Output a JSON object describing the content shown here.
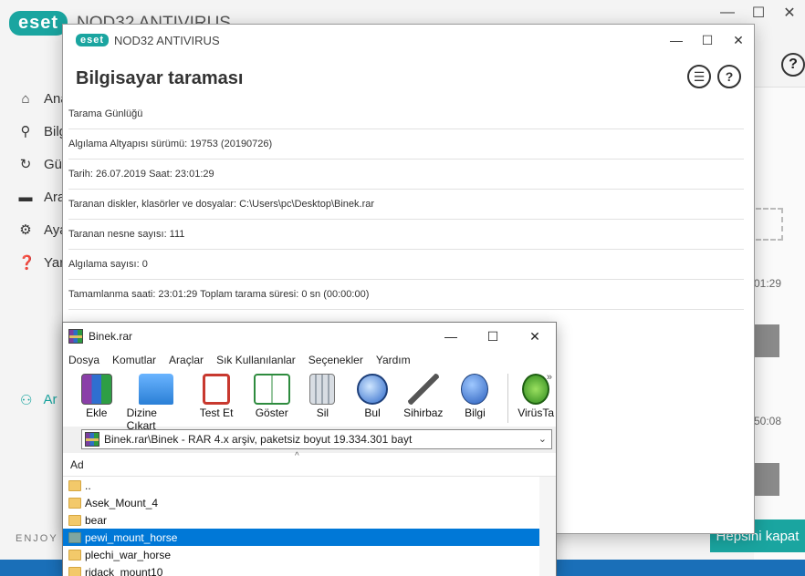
{
  "background_app": {
    "logo": "eset",
    "title": "NOD32 ANTIVIRUS",
    "window_controls": {
      "minimize": "—",
      "maximize": "☐",
      "close": "✕"
    },
    "help_label": "?",
    "nav_items": [
      {
        "label": "Ana",
        "icon": "home-icon"
      },
      {
        "label": "Bilg",
        "icon": "search-icon"
      },
      {
        "label": "Gü",
        "icon": "refresh-icon"
      },
      {
        "label": "Ara",
        "icon": "toolbox-icon"
      },
      {
        "label": "Aya",
        "icon": "gear-icon"
      },
      {
        "label": "Yar",
        "icon": "question-icon"
      }
    ],
    "nav_footer_item": "Ar",
    "enjoy_text": "ENJOY S",
    "right_times": [
      "01:29",
      "50:08"
    ],
    "hepsini_kapat": "Hepsini kapat"
  },
  "scan_window": {
    "logo": "eset",
    "title": "NOD32 ANTIVIRUS",
    "heading": "Bilgisayar taraması",
    "window_controls": {
      "minimize": "—",
      "maximize": "☐",
      "close": "✕"
    },
    "list_icon_label": "☰",
    "help_label": "?",
    "log_rows": [
      "Tarama Günlüğü",
      "Algılama Altyapısı sürümü: 19753 (20190726)",
      "Tarih: 26.07.2019  Saat: 23:01:29",
      "Taranan diskler, klasörler ve dosyalar: C:\\Users\\pc\\Desktop\\Binek.rar",
      "Taranan nesne sayısı: 111",
      "Algılama sayısı: 0",
      "Tamamlanma saati: 23:01:29  Toplam tarama süresi: 0 sn (00:00:00)"
    ]
  },
  "rar_window": {
    "title": "Binek.rar",
    "window_controls": {
      "minimize": "—",
      "maximize": "☐",
      "close": "✕"
    },
    "menu": [
      "Dosya",
      "Komutlar",
      "Araçlar",
      "Sık Kullanılanlar",
      "Seçenekler",
      "Yardım"
    ],
    "toolbar": [
      {
        "label": "Ekle",
        "icon": "add-archive-icon"
      },
      {
        "label": "Dizine Çıkart",
        "icon": "extract-folder-icon"
      },
      {
        "label": "Test Et",
        "icon": "test-clipboard-icon"
      },
      {
        "label": "Göster",
        "icon": "book-view-icon"
      },
      {
        "label": "Sil",
        "icon": "trash-icon"
      },
      {
        "label": "Bul",
        "icon": "find-magnifier-icon"
      },
      {
        "label": "Sihirbaz",
        "icon": "wizard-wand-icon"
      },
      {
        "label": "Bilgi",
        "icon": "info-icon"
      },
      {
        "label": "VirüsTa",
        "icon": "virus-scan-icon"
      }
    ],
    "toolbar_more": "»",
    "path": "Binek.rar\\Binek - RAR 4.x arşiv, paketsiz boyut 19.334.301 bayt",
    "column_header": "Ad",
    "sort_indicator": "^",
    "files": [
      {
        "name": "..",
        "selected": false
      },
      {
        "name": "Asek_Mount_4",
        "selected": false
      },
      {
        "name": "bear",
        "selected": false
      },
      {
        "name": "pewi_mount_horse",
        "selected": true
      },
      {
        "name": "plechi_war_horse",
        "selected": false
      },
      {
        "name": "ridack_mount10",
        "selected": false
      }
    ],
    "colors": {
      "selection": "#0078d7",
      "folder": "#f3c96a"
    }
  },
  "colors": {
    "eset_teal": "#1aa5a0",
    "taskbar_blue": "#1a6fb8"
  }
}
